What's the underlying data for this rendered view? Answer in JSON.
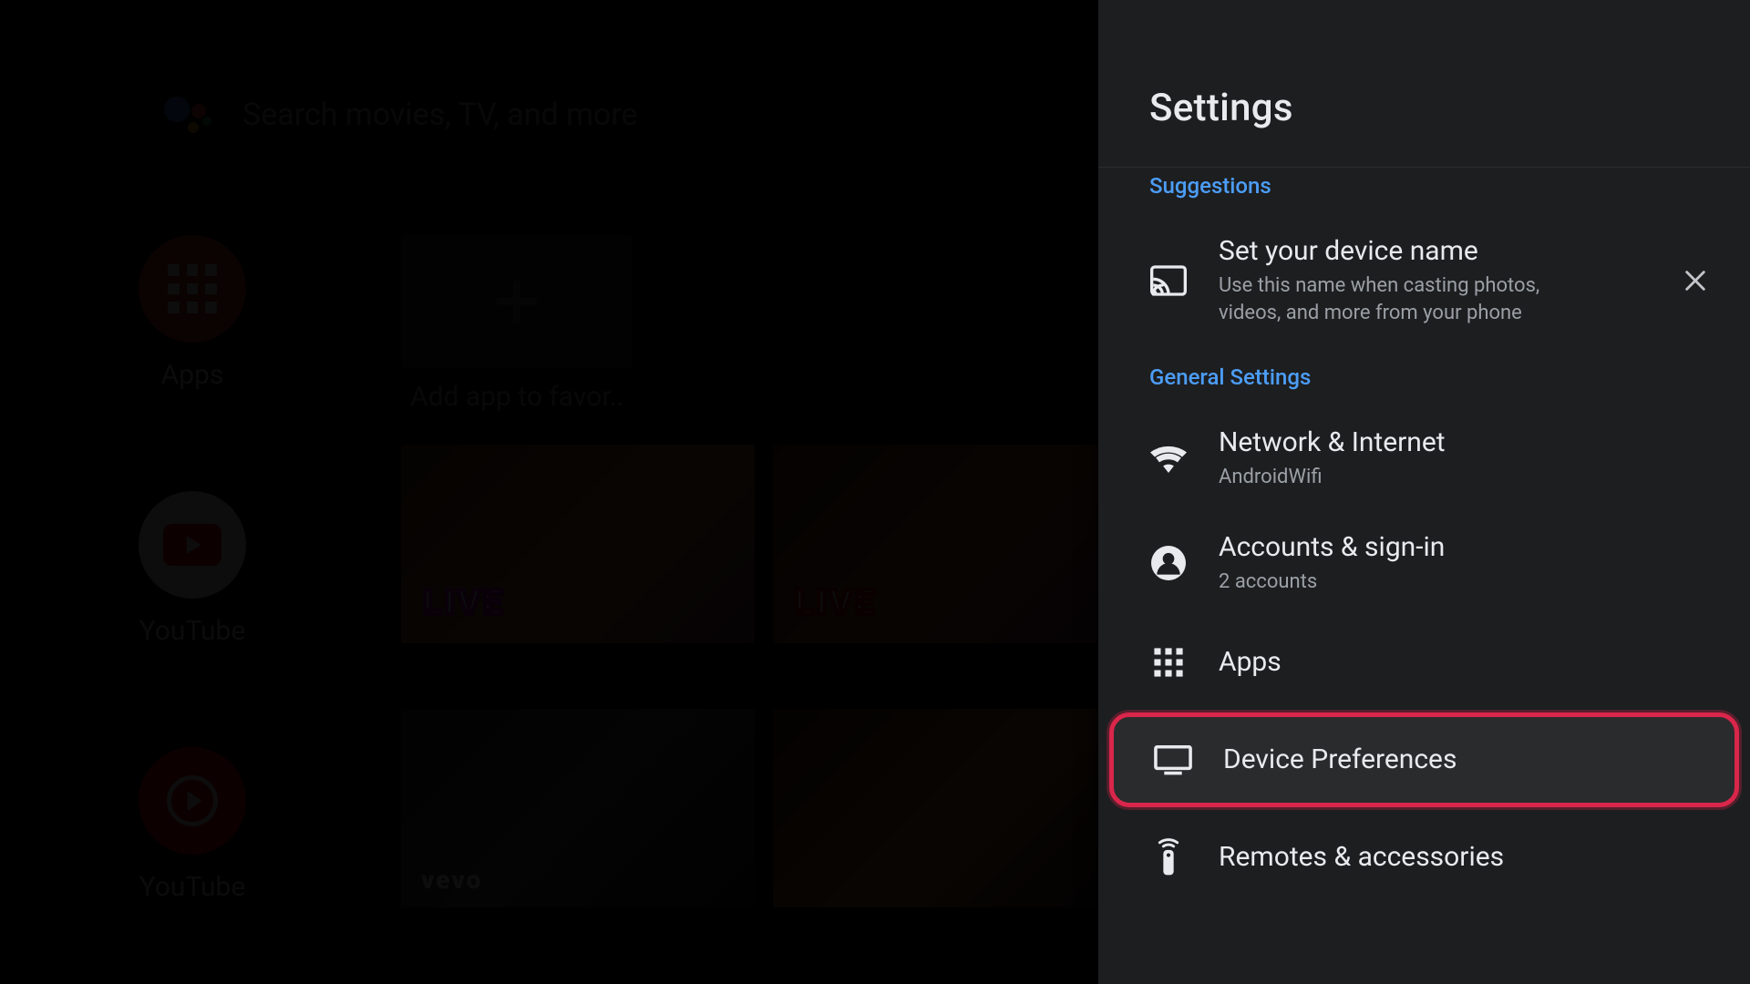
{
  "search": {
    "placeholder": "Search movies, TV, and more"
  },
  "home": {
    "apps_label": "Apps",
    "youtube_label": "YouTube",
    "youtube_music_label": "YouTube",
    "add_favorite_label": "Add app to favor..",
    "thumbs": {
      "live1": "LIVE",
      "live2": "LIVE",
      "vevo": "vevo"
    }
  },
  "panel": {
    "title": "Settings",
    "sections": {
      "suggestions_label": "Suggestions",
      "general_label": "General Settings"
    },
    "suggestion": {
      "title": "Set your device name",
      "subtitle": "Use this name when casting photos, videos, and more from your phone"
    },
    "items": {
      "network": {
        "title": "Network & Internet",
        "sub": "AndroidWifi"
      },
      "accounts": {
        "title": "Accounts & sign-in",
        "sub": "2 accounts"
      },
      "apps": {
        "title": "Apps"
      },
      "device_prefs": {
        "title": "Device Preferences"
      },
      "remotes": {
        "title": "Remotes & accessories"
      }
    }
  }
}
